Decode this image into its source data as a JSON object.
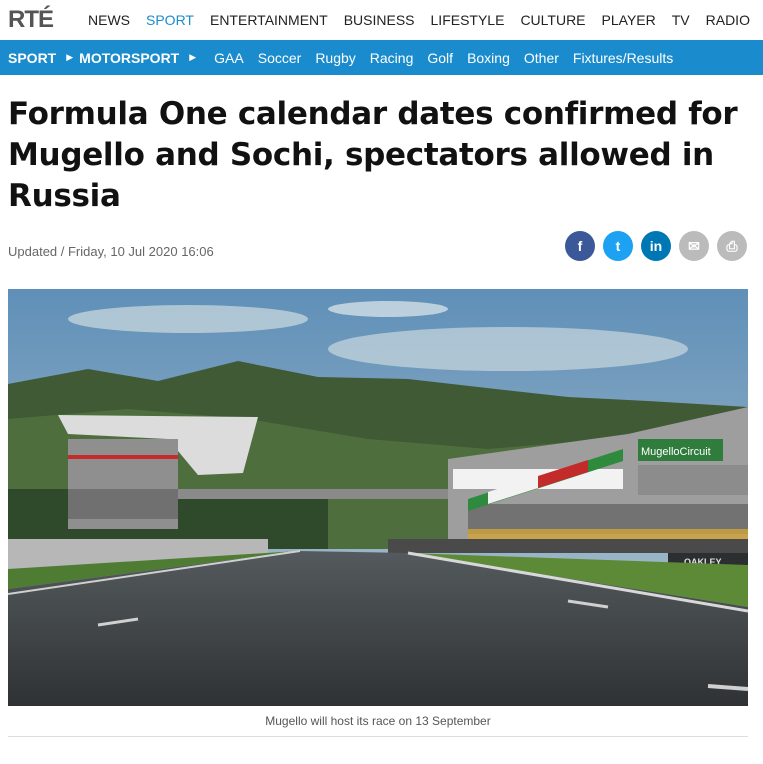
{
  "logo": "RTÉ",
  "top_nav": [
    "NEWS",
    "SPORT",
    "ENTERTAINMENT",
    "BUSINESS",
    "LIFESTYLE",
    "CULTURE",
    "PLAYER",
    "TV",
    "RADIO"
  ],
  "top_nav_active": "SPORT",
  "sub_nav": {
    "crumbs": [
      "SPORT",
      "MOTORSPORT"
    ],
    "items": [
      "GAA",
      "Soccer",
      "Rugby",
      "Racing",
      "Golf",
      "Boxing",
      "Other",
      "Fixtures/Results"
    ]
  },
  "article": {
    "headline": "Formula One calendar dates confirmed for Mugello and Sochi, spectators allowed in Russia",
    "updated": "Updated / Friday, 10 Jul 2020 16:06",
    "caption": "Mugello will host its race on 13 September"
  },
  "share_icons": [
    {
      "name": "facebook-icon",
      "color": "#3b5998",
      "glyph": "f"
    },
    {
      "name": "twitter-icon",
      "color": "#1da1f2",
      "glyph": "t"
    },
    {
      "name": "linkedin-icon",
      "color": "#0077b5",
      "glyph": "in"
    },
    {
      "name": "email-icon",
      "color": "#bbbbbb",
      "glyph": "✉"
    },
    {
      "name": "print-icon",
      "color": "#bbbbbb",
      "glyph": "⎙"
    }
  ],
  "image_signage": {
    "circuit": "MugelloCircuit",
    "sponsor": "OAKLEY"
  },
  "colors": {
    "accent": "#1a8ccd"
  }
}
